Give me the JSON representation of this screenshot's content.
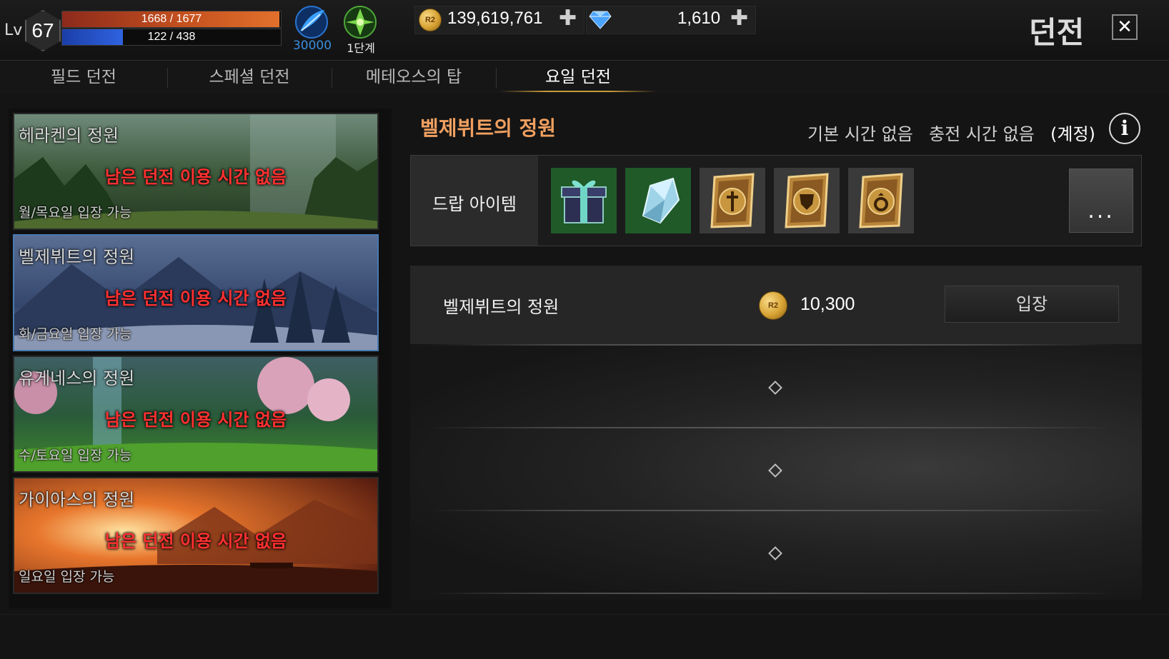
{
  "player": {
    "level_prefix": "Lv",
    "level": "67",
    "hp_text": "1668 / 1677",
    "hp_fraction": 0.995,
    "mp_text": "122 / 438",
    "mp_fraction": 0.279,
    "feather_value": "30000",
    "stage_label": "1단계"
  },
  "currency": {
    "gold": "139,619,761",
    "gems": "1,610",
    "coin_mark": "R2"
  },
  "header": {
    "title": "던전",
    "close_glyph": "✕"
  },
  "tabs": [
    {
      "label": "필드 던전",
      "active": false
    },
    {
      "label": "스페셜 던전",
      "active": false
    },
    {
      "label": "메테오스의 탑",
      "active": false
    },
    {
      "label": "요일 던전",
      "active": true
    }
  ],
  "dungeons": [
    {
      "name": "헤라켄의 정원",
      "status": "남은 던전 이용 시간 없음",
      "days": "월/목요일 입장 가능",
      "theme": "forest",
      "selected": false
    },
    {
      "name": "벨제뷔트의 정원",
      "status": "남은 던전 이용 시간 없음",
      "days": "화/금요일 입장 가능",
      "theme": "snow",
      "selected": true
    },
    {
      "name": "유게네스의 정원",
      "status": "남은 던전 이용 시간 없음",
      "days": "수/토요일 입장 가능",
      "theme": "blossom",
      "selected": false
    },
    {
      "name": "가이아스의 정원",
      "status": "남은 던전 이용 시간 없음",
      "days": "일요일 입장 가능",
      "theme": "sunset",
      "selected": false
    }
  ],
  "detail": {
    "title": "벨제뷔트의 정원",
    "base_time": "기본 시간 없음",
    "charge_time": "충전 시간 없음",
    "account": "(계정)",
    "info_glyph": "i",
    "drop_label": "드랍 아이템",
    "drop_items": [
      {
        "icon": "gift-box-icon",
        "bg": "green"
      },
      {
        "icon": "crystal-icon",
        "bg": "green"
      },
      {
        "icon": "sword-card-icon",
        "bg": "grey"
      },
      {
        "icon": "shield-card-icon",
        "bg": "grey"
      },
      {
        "icon": "ring-card-icon",
        "bg": "grey"
      }
    ],
    "more_label": "...",
    "entry": {
      "name": "벨제뷔트의 정원",
      "cost": "10,300",
      "enter_label": "입장"
    }
  },
  "colors": {
    "accent_orange": "#f0a060",
    "status_red": "#ff3030",
    "tab_underline": "#c99a3a",
    "feather_blue": "#3a8de0"
  }
}
